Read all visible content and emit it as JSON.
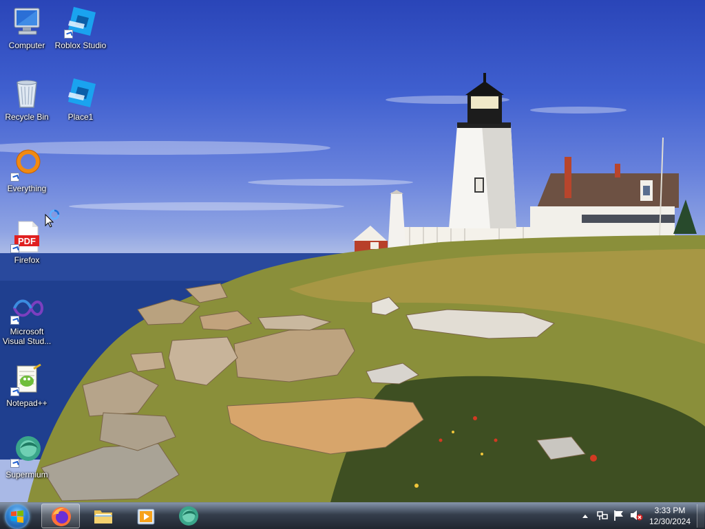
{
  "desktop": {
    "icons": [
      {
        "label": "Computer",
        "icon": "computer-icon"
      },
      {
        "label": "Roblox Studio",
        "icon": "roblox-studio-icon"
      },
      {
        "label": "Recycle Bin",
        "icon": "recycle-bin-icon"
      },
      {
        "label": "Place1",
        "icon": "roblox-studio-icon"
      },
      {
        "label": "Everything",
        "icon": "everything-search-icon"
      },
      {
        "label": "Firefox",
        "icon": "pdf-file-icon",
        "badge": "PDF"
      },
      {
        "label": "Microsoft Visual Stud...",
        "icon": "visual-studio-icon"
      },
      {
        "label": "Notepad++",
        "icon": "notepad-plus-plus-icon"
      },
      {
        "label": "Supermium",
        "icon": "supermium-icon"
      }
    ]
  },
  "taskbar": {
    "start": {
      "icon": "windows-start-orb-icon"
    },
    "pinned": [
      {
        "name": "Firefox",
        "icon": "firefox-icon",
        "active": true
      },
      {
        "name": "File Explorer",
        "icon": "folder-icon",
        "active": false
      },
      {
        "name": "Media Player",
        "icon": "media-player-icon",
        "active": false
      },
      {
        "name": "Supermium",
        "icon": "supermium-icon",
        "active": false
      }
    ],
    "tray": {
      "icons": [
        "show-hidden-icons-chevron",
        "network-icon",
        "action-center-flag-icon",
        "volume-muted-icon"
      ],
      "time": "3:33 PM",
      "date": "12/30/2024"
    }
  },
  "colors": {
    "taskbar": "#1c2433",
    "sky": "#3f5fcf",
    "sea": "#1f3f8f",
    "grass": "#8a8f3a"
  }
}
